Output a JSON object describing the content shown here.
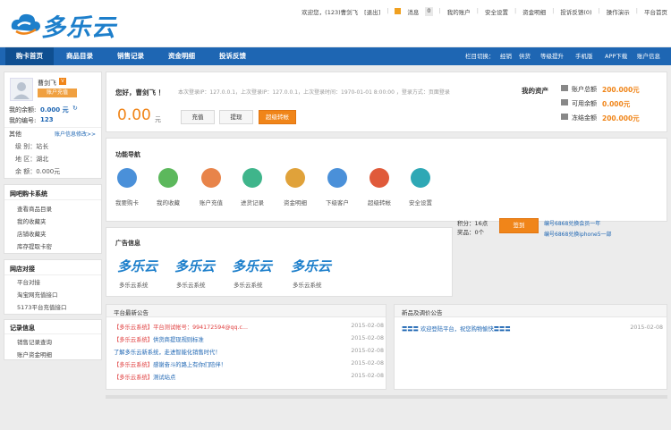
{
  "header": {
    "logo_text": "多乐云",
    "toplinks": [
      "欢迎您，(123)曹剑飞",
      "[退出]",
      "消息",
      "0",
      "我的账户",
      "安全设置",
      "资金明细",
      "投诉反馈(0)",
      "操作演示",
      "平台首页"
    ]
  },
  "nav": {
    "items": [
      "购卡首页",
      "商品目录",
      "销售记录",
      "资金明细",
      "投诉反馈"
    ],
    "right_label": "栏目切换：",
    "right_items": [
      "经销",
      "供货",
      "等级提升",
      "手机版",
      "APP下载",
      "账户信息"
    ]
  },
  "profile": {
    "name": "曹剑飞",
    "badge": "账户充值",
    "balance_label": "我的余额:",
    "balance": "0.000 元",
    "id_label": "我的编号:",
    "id": "123",
    "other_label": "其他",
    "edit_link": "账户信息修改>>",
    "level": "级 别：站长",
    "region": "地 区：湖北",
    "amount": "余 额：0.000元"
  },
  "sidebar": {
    "sections": [
      {
        "title": "网吧购卡系统",
        "items": [
          "查看商品目录",
          "我的收藏夹",
          "店铺收藏夹",
          "库存提取卡密"
        ]
      },
      {
        "title": "网店对接",
        "items": [
          "平台对接",
          "淘宝网充值接口",
          "5173平台充值接口"
        ]
      },
      {
        "title": "记录信息",
        "items": [
          "销售记录查询",
          "账户资金明细"
        ]
      }
    ]
  },
  "welcome": {
    "greeting": "您好，曹剑飞 ！",
    "login_info": "本次登录IP：127.0.0.1，上次登录IP：127.0.0.1，上次登录时间：1970-01-01 8:00:00 ，登录方式：页面登录",
    "balance": "0.00",
    "unit": "元",
    "btn_recharge": "充值",
    "btn_withdraw": "提现",
    "btn_transfer": "超级转帐"
  },
  "assets": {
    "title": "我的资产",
    "rows": [
      {
        "label": "账户总额",
        "value": "200.000元"
      },
      {
        "label": "可用余额",
        "value": "0.000元"
      },
      {
        "label": "冻结金额",
        "value": "200.000元"
      }
    ]
  },
  "functions": {
    "title": "功能导航",
    "items": [
      {
        "label": "我要购卡",
        "icon": "cart-icon",
        "color": "#4a90d9"
      },
      {
        "label": "我的收藏",
        "icon": "star-icon",
        "color": "#5cb85c"
      },
      {
        "label": "账户充值",
        "icon": "recharge-icon",
        "color": "#e8844a"
      },
      {
        "label": "进货记录",
        "icon": "stock-icon",
        "color": "#3fb58b"
      },
      {
        "label": "资金明细",
        "icon": "ledger-icon",
        "color": "#e0a23a"
      },
      {
        "label": "下级客户",
        "icon": "client-icon",
        "color": "#4a90d9"
      },
      {
        "label": "超级转帐",
        "icon": "transfer-icon",
        "color": "#e05a3a"
      },
      {
        "label": "安全设置",
        "icon": "shield-icon",
        "color": "#2ea8b5"
      }
    ]
  },
  "points": {
    "score_label": "积分：",
    "score": "16点",
    "prize_label": "奖品：",
    "prize": "0个",
    "signin": "签到",
    "links": [
      "编号6868兑换会员一年",
      "编号6868兑换iphone5一部"
    ]
  },
  "ads": {
    "title": "广告信息",
    "items": [
      {
        "logo": "多乐云",
        "caption": "多乐云系统"
      },
      {
        "logo": "多乐云",
        "caption": "多乐云系统"
      },
      {
        "logo": "多乐云",
        "caption": "多乐云系统"
      },
      {
        "logo": "多乐云",
        "caption": "多乐云系统"
      }
    ]
  },
  "notices": {
    "title": "平台最新公告",
    "rows": [
      {
        "tag": "【多乐云系统】",
        "text": "平台测试帐号：994172594@qq.c...",
        "date": "2015-02-08",
        "red": true
      },
      {
        "tag": "【多乐云系统】",
        "text": "供货商提现规则标准",
        "date": "2015-02-08",
        "red": false
      },
      {
        "tag": "",
        "text": "了解多乐云新系统，走进智能化销售时代！",
        "date": "2015-02-08",
        "red": false
      },
      {
        "tag": "【多乐云系统】",
        "text": "感谢奋斗的路上有你们陪伴！",
        "date": "2015-02-08",
        "red": false
      },
      {
        "tag": "【多乐云系统】",
        "text": "测试站点",
        "date": "2015-02-08",
        "red": false
      }
    ]
  },
  "products": {
    "title": "新品及调价公告",
    "rows": [
      {
        "text": "〓〓〓 欢迎登陆平台，祝您购物愉快〓〓〓",
        "date": "2015-02-08"
      }
    ]
  }
}
